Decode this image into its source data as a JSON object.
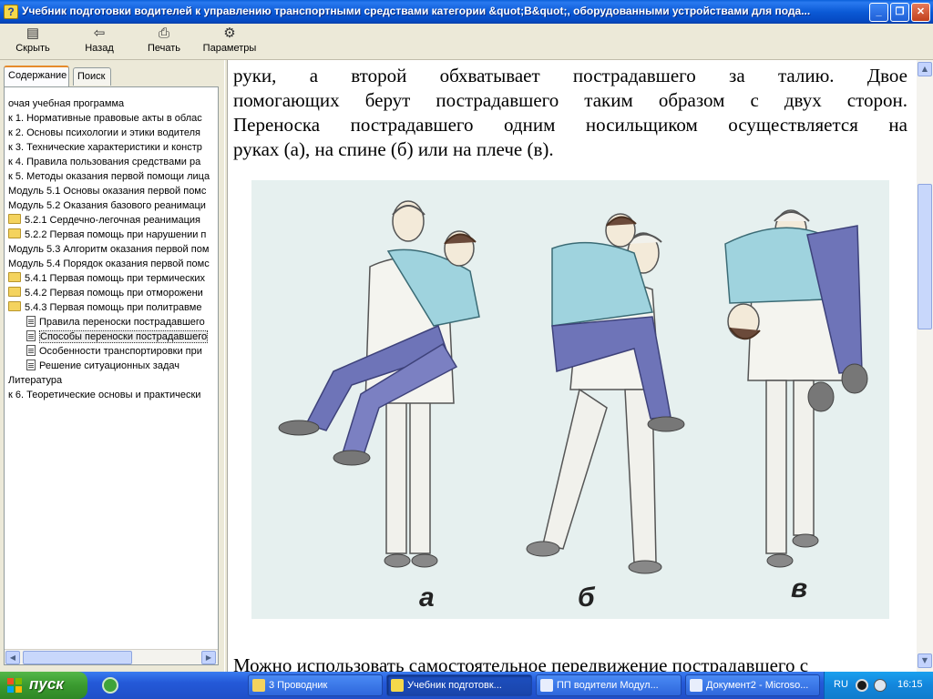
{
  "window": {
    "title": "Учебник подготовки водителей к управлению транспортными средствами категории &quot;B&quot;, оборудованными устройствами для пода..."
  },
  "toolbar": {
    "hide": "Скрыть",
    "back": "Назад",
    "print": "Печать",
    "options": "Параметры"
  },
  "nav": {
    "tab_contents": "Содержание",
    "tab_search": "Поиск",
    "items": [
      "очая учебная программа",
      "к 1. Нормативные правовые акты в облас",
      "к 2. Основы психологии и этики водителя",
      "к 3. Технические характеристики и констр",
      "к 4. Правила пользования средствами ра",
      "к 5. Методы оказания первой помощи лица",
      "Модуль 5.1 Основы оказания первой помс",
      "Модуль 5.2 Оказания базового реанимаци",
      "5.2.1 Сердечно-легочная реанимация",
      "5.2.2 Первая помощь при нарушении п",
      "Модуль 5.3 Алгоритм оказания первой пом",
      "Модуль 5.4 Порядок оказания первой помс",
      "5.4.1 Первая помощь при термических",
      "5.4.2 Первая помощь при отморожени",
      "5.4.3 Первая помощь при политравме",
      "Правила переноски пострадавшего",
      "Способы переноски пострадавшего",
      "Особенности транспортировки при",
      "Решение ситуационных задач",
      "Литература",
      "к 6. Теоретические основы и практически"
    ]
  },
  "content": {
    "line1": "руки, а второй обхватывает пострадавшего за талию. Двое",
    "line2": "помогающих берут пострадавшего таким образом с двух сторон.",
    "line3": "Переноска пострадавшего одним носильщиком осуществляется на",
    "line4": "руках (а), на спине (б) или на плече (в).",
    "bottom_line": "Можно использовать самостоятельное передвижение пострадавшего с",
    "figure_labels": [
      "а",
      "б",
      "в"
    ]
  },
  "taskbar": {
    "start": "пуск",
    "tasks": [
      "3 Проводник",
      "Учебник подготовк...",
      "ПП водители Модул...",
      "Документ2 - Microso..."
    ],
    "lang": "RU",
    "clock": "16:15"
  },
  "colors": {
    "title_blue": "#0b5ad6",
    "figure_bg": "#e6f0ef",
    "shirt_blue": "#9fd3de",
    "trousers": "#6e74b8"
  }
}
